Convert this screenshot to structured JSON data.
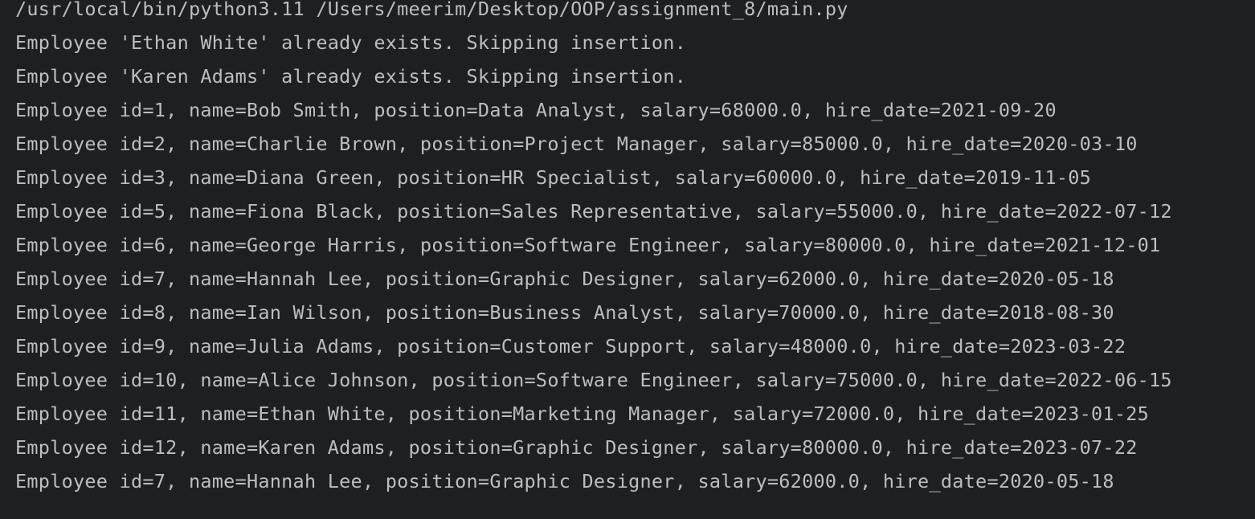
{
  "console": {
    "command": "/usr/local/bin/python3.11 /Users/meerim/Desktop/OOP/assignment_8/main.py",
    "lines": [
      "Employee 'Ethan White' already exists. Skipping insertion.",
      "Employee 'Karen Adams' already exists. Skipping insertion.",
      "Employee id=1, name=Bob Smith, position=Data Analyst, salary=68000.0, hire_date=2021-09-20",
      "Employee id=2, name=Charlie Brown, position=Project Manager, salary=85000.0, hire_date=2020-03-10",
      "Employee id=3, name=Diana Green, position=HR Specialist, salary=60000.0, hire_date=2019-11-05",
      "Employee id=5, name=Fiona Black, position=Sales Representative, salary=55000.0, hire_date=2022-07-12",
      "Employee id=6, name=George Harris, position=Software Engineer, salary=80000.0, hire_date=2021-12-01",
      "Employee id=7, name=Hannah Lee, position=Graphic Designer, salary=62000.0, hire_date=2020-05-18",
      "Employee id=8, name=Ian Wilson, position=Business Analyst, salary=70000.0, hire_date=2018-08-30",
      "Employee id=9, name=Julia Adams, position=Customer Support, salary=48000.0, hire_date=2023-03-22",
      "Employee id=10, name=Alice Johnson, position=Software Engineer, salary=75000.0, hire_date=2022-06-15",
      "Employee id=11, name=Ethan White, position=Marketing Manager, salary=72000.0, hire_date=2023-01-25",
      "Employee id=12, name=Karen Adams, position=Graphic Designer, salary=80000.0, hire_date=2023-07-22",
      "Employee id=7, name=Hannah Lee, position=Graphic Designer, salary=62000.0, hire_date=2020-05-18"
    ],
    "colors": {
      "background": "#1e1f22",
      "text": "#bcbec4"
    }
  }
}
